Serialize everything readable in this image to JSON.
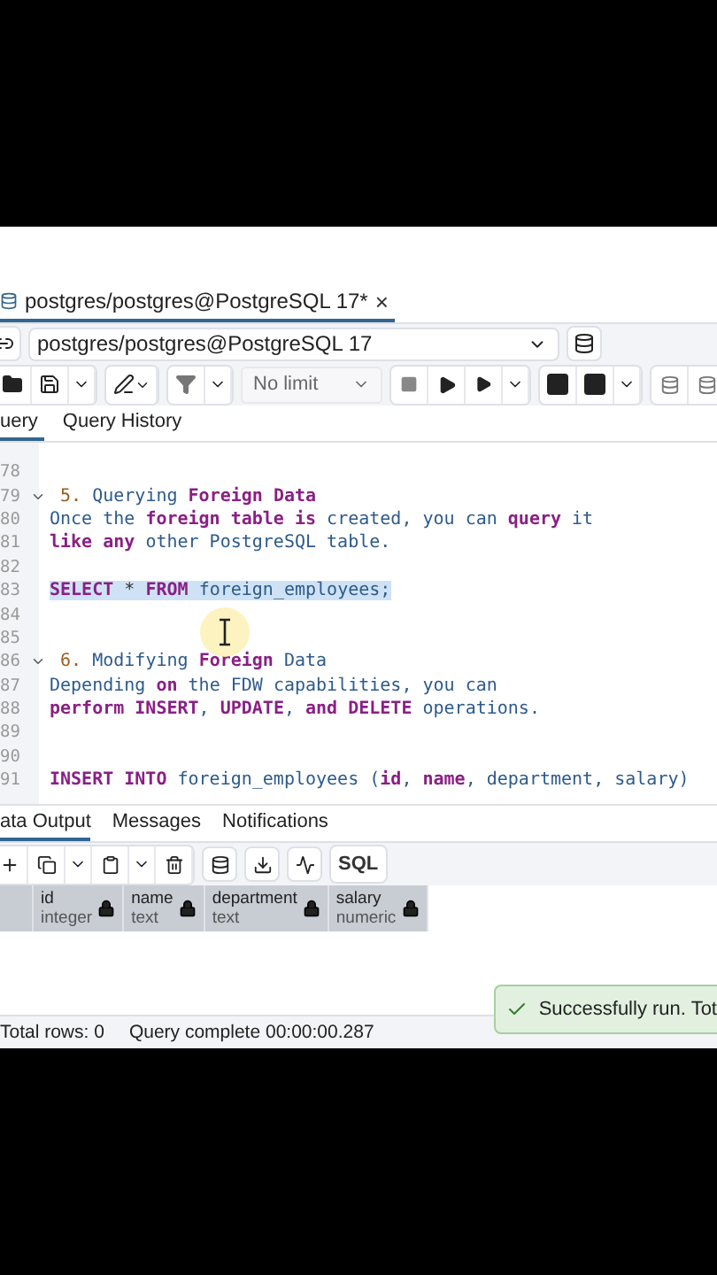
{
  "editor_tab": {
    "title": "postgres/postgres@PostgreSQL 17*",
    "close": "×",
    "selected": true
  },
  "connection": {
    "value": "postgres/postgres@PostgreSQL 17"
  },
  "toolbar": {
    "limit": "No limit"
  },
  "query_tabs": [
    {
      "label": "uery",
      "selected": true
    },
    {
      "label": "Query History",
      "selected": false
    }
  ],
  "code_lines": [
    {
      "number": "78"
    },
    {
      "number": "79",
      "fold": {
        "expanded": true
      },
      "tokens": [
        {
          "kind": "num",
          "text": " 5. "
        },
        {
          "kind": "id",
          "text": "Querying "
        },
        {
          "kind": "kw",
          "text": "Foreign Data"
        }
      ]
    },
    {
      "number": "80",
      "tokens": [
        {
          "kind": "id",
          "text": "Once the "
        },
        {
          "kind": "kw",
          "text": "foreign table is "
        },
        {
          "kind": "id",
          "text": "created, you can "
        },
        {
          "kind": "kw",
          "text": "query "
        },
        {
          "kind": "id",
          "text": "it"
        }
      ]
    },
    {
      "number": "81",
      "tokens": [
        {
          "kind": "kw",
          "text": "like any "
        },
        {
          "kind": "id",
          "text": "other PostgreSQL table."
        }
      ]
    },
    {
      "number": "82"
    },
    {
      "number": "83",
      "selected": true,
      "tokens": [
        {
          "kind": "kw",
          "text": "SELECT "
        },
        {
          "kind": "op",
          "text": "* "
        },
        {
          "kind": "kw",
          "text": "FROM "
        },
        {
          "kind": "id",
          "text": "foreign_employees;"
        }
      ]
    },
    {
      "number": "84"
    },
    {
      "number": "85"
    },
    {
      "number": "86",
      "fold": {
        "expanded": true
      },
      "tokens": [
        {
          "kind": "num",
          "text": " 6. "
        },
        {
          "kind": "id",
          "text": "Modifying "
        },
        {
          "kind": "kw",
          "text": "Foreign "
        },
        {
          "kind": "id",
          "text": "Data"
        }
      ]
    },
    {
      "number": "87",
      "tokens": [
        {
          "kind": "id",
          "text": "Depending "
        },
        {
          "kind": "kw",
          "text": "on "
        },
        {
          "kind": "id",
          "text": "the FDW capabilities, you can"
        }
      ]
    },
    {
      "number": "88",
      "tokens": [
        {
          "kind": "kw",
          "text": "perform INSERT"
        },
        {
          "kind": "id",
          "text": ", "
        },
        {
          "kind": "kw",
          "text": "UPDATE"
        },
        {
          "kind": "id",
          "text": ", "
        },
        {
          "kind": "kw",
          "text": "and DELETE "
        },
        {
          "kind": "id",
          "text": "operations."
        }
      ]
    },
    {
      "number": "89"
    },
    {
      "number": "90"
    },
    {
      "number": "91",
      "tokens": [
        {
          "kind": "kw",
          "text": "INSERT INTO "
        },
        {
          "kind": "id",
          "text": "foreign_employees ("
        },
        {
          "kind": "kw",
          "text": "id"
        },
        {
          "kind": "id",
          "text": ", "
        },
        {
          "kind": "kw",
          "text": "name"
        },
        {
          "kind": "id",
          "text": ", department, salary)"
        }
      ]
    }
  ],
  "output_tabs": [
    {
      "label": "ata Output",
      "selected": true
    },
    {
      "label": "Messages",
      "selected": false
    },
    {
      "label": "Notifications",
      "selected": false
    }
  ],
  "output_toolbar": {
    "sql": "SQL"
  },
  "columns": [
    {
      "name": "id",
      "type": "integer"
    },
    {
      "name": "name",
      "type": "text"
    },
    {
      "name": "department",
      "type": "text"
    },
    {
      "name": "salary",
      "type": "numeric"
    }
  ],
  "toast": {
    "text": "Successfully run. Tot"
  },
  "status": {
    "rows": "Total rows: 0",
    "query": "Query complete 00:00:00.287"
  }
}
